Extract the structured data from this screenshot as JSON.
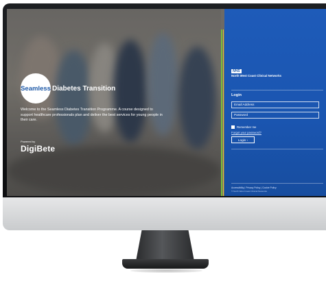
{
  "hero": {
    "logo_word": "Seamless",
    "logo_suffix": "Diabetes Transition",
    "welcome_text": "Welcome to the Seamless Diabetes Transition Programme. A course designed to support healthcare professionals plan and deliver the best services for young people in their care.",
    "powered_by": "Powered by",
    "partner_logo": "DigiBete"
  },
  "login_panel": {
    "nhs_badge": "NHS",
    "org_name": "North West Coast Clinical Networks",
    "title": "Login",
    "email_placeholder": "Email Address",
    "password_placeholder": "Password",
    "remember_label": "Remember me",
    "forgot_link": "Forgot your password?",
    "login_button": "Login ›",
    "footer_links": "Accessibility | Privacy Policy | Cookie Policy",
    "copyright": "© North West Coast Clinical Networks"
  },
  "colors": {
    "panel_blue": "#1e5bb9",
    "stripe_green": "#7bbf3a",
    "stripe_yellow": "#e7c53a",
    "logo_blue": "#1f5aa8"
  },
  "icons": {
    "checkbox": "checkbox-icon",
    "chevron": "chevron-right-icon"
  }
}
